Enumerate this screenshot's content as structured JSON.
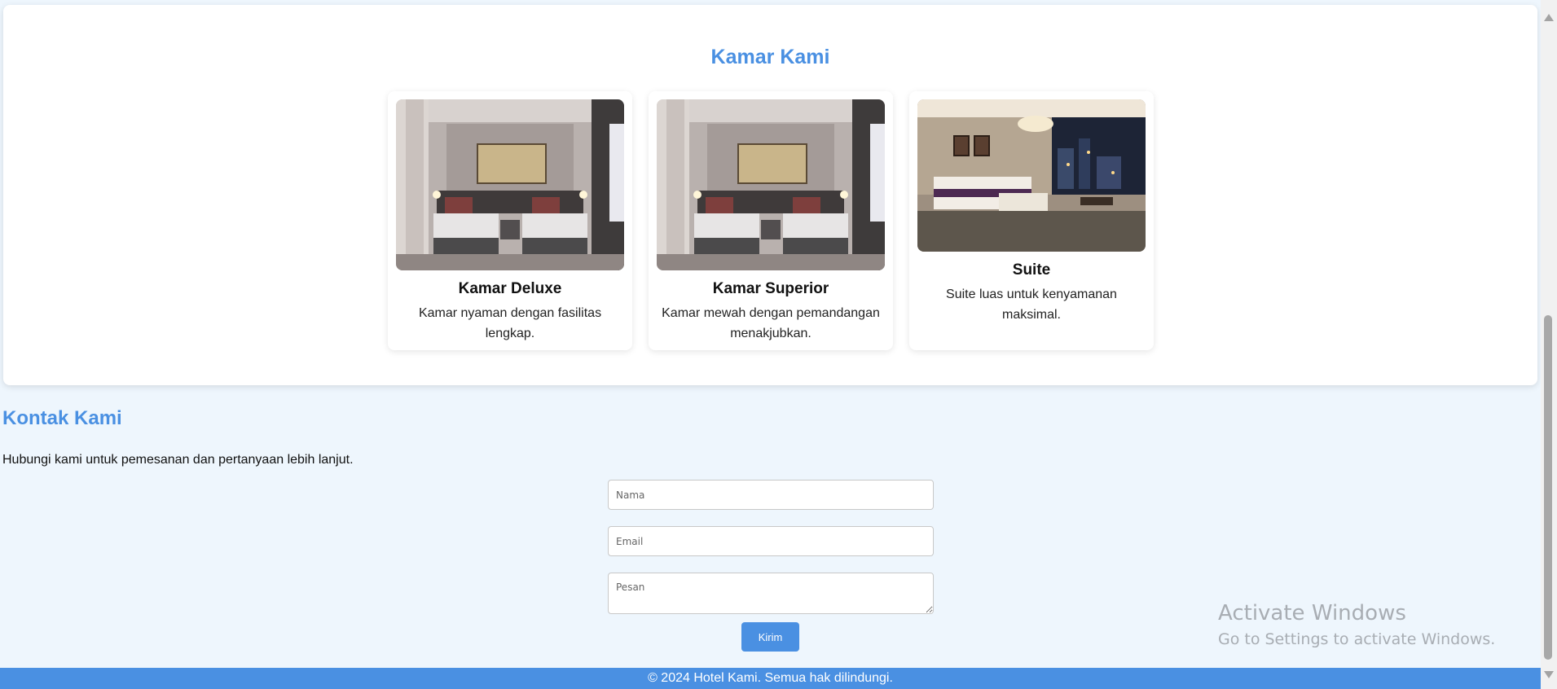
{
  "rooms": {
    "title": "Kamar Kami",
    "items": [
      {
        "name": "Kamar Deluxe",
        "description": "Kamar nyaman dengan fasilitas lengkap.",
        "image": "twin-bed-room-photo"
      },
      {
        "name": "Kamar Superior",
        "description": "Kamar mewah dengan pemandangan menakjubkan.",
        "image": "twin-bed-room-photo"
      },
      {
        "name": "Suite",
        "description": "Suite luas untuk kenyamanan maksimal.",
        "image": "suite-room-city-view-photo"
      }
    ]
  },
  "contact": {
    "title": "Kontak Kami",
    "text": "Hubungi kami untuk pemesanan dan pertanyaan lebih lanjut.",
    "name_placeholder": "Nama",
    "email_placeholder": "Email",
    "message_placeholder": "Pesan",
    "submit_label": "Kirim"
  },
  "footer": {
    "text": "© 2024 Hotel Kami. Semua hak dilindungi."
  },
  "watermark": {
    "line1": "Activate Windows",
    "line2": "Go to Settings to activate Windows."
  },
  "colors": {
    "accent": "#4a90e2",
    "page_bg": "#eef6fd"
  }
}
